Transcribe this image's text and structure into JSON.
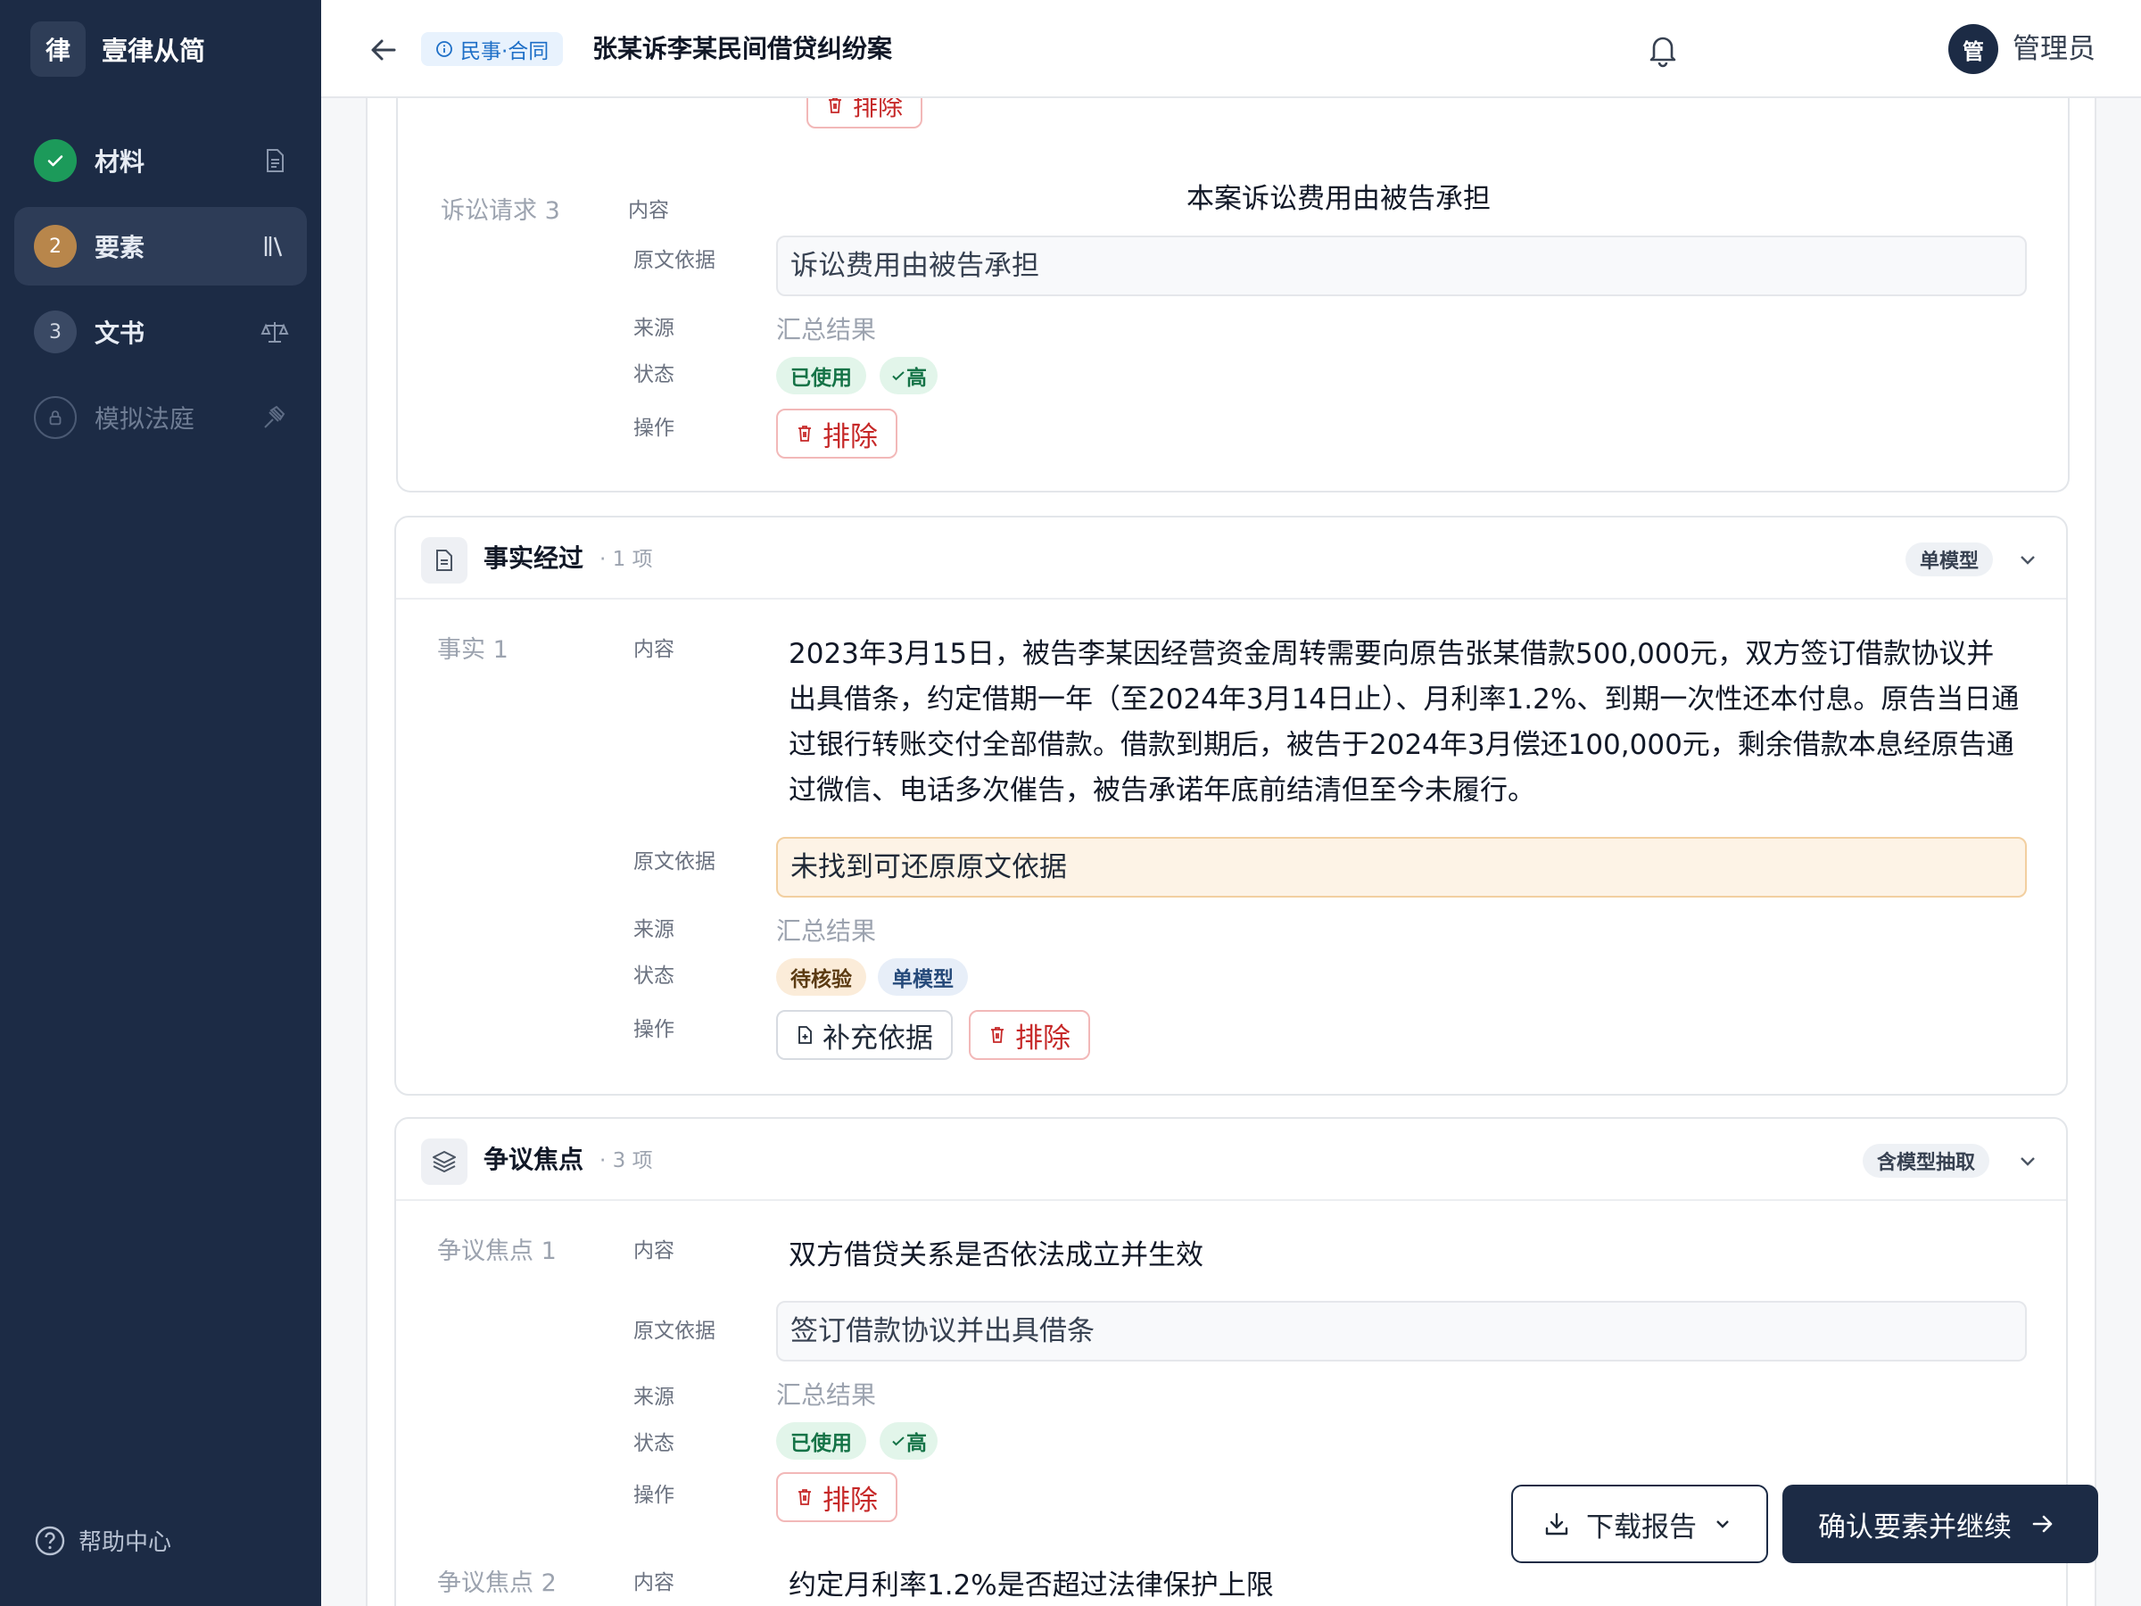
{
  "brand": {
    "logo": "律",
    "name": "壹律从简"
  },
  "nav": [
    {
      "label": "材料",
      "badge": "✓",
      "state": "done",
      "icon": "document-icon"
    },
    {
      "label": "要素",
      "badge": "2",
      "state": "current",
      "icon": "library-icon"
    },
    {
      "label": "文书",
      "badge": "3",
      "state": "pending",
      "icon": "scales-icon"
    },
    {
      "label": "模拟法庭",
      "badge": "",
      "state": "locked",
      "icon": "gavel-icon"
    }
  ],
  "help": {
    "label": "帮助中心"
  },
  "header": {
    "case_tag": "民事·合同",
    "case_title": "张某诉李某民间借贷纠纷案",
    "avatar": "管",
    "user": "管理员"
  },
  "labels": {
    "content": "内容",
    "basis": "原文依据",
    "source": "来源",
    "status": "状态",
    "action": "操作",
    "exclude": "排除",
    "supplement": "补充依据"
  },
  "claim3": {
    "row_label": "诉讼请求 3",
    "content": "本案诉讼费用由被告承担",
    "basis": "诉讼费用由被告承担",
    "source": "汇总结果",
    "status_used": "已使用",
    "confidence": "高"
  },
  "facts": {
    "title": "事实经过",
    "count": "· 1 项",
    "model_badge": "单模型",
    "items": [
      {
        "row_label": "事实 1",
        "content": "2023年3月15日，被告李某因经营资金周转需要向原告张某借款500,000元，双方签订借款协议并出具借条，约定借期一年（至2024年3月14日止）、月利率1.2%、到期一次性还本付息。原告当日通过银行转账交付全部借款。借款到期后，被告于2024年3月偿还100,000元，剩余借款本息经原告通过微信、电话多次催告，被告承诺年底前结清但至今未履行。",
        "basis": "未找到可还原原文依据",
        "source": "汇总结果",
        "status_pending": "待核验",
        "status_model": "单模型"
      }
    ]
  },
  "disputes": {
    "title": "争议焦点",
    "count": "· 3 项",
    "model_badge": "含模型抽取",
    "items": [
      {
        "row_label": "争议焦点 1",
        "content": "双方借贷关系是否依法成立并生效",
        "basis": "签订借款协议并出具借条",
        "source": "汇总结果",
        "status_used": "已使用",
        "confidence": "高"
      },
      {
        "row_label": "争议焦点 2",
        "content": "约定月利率1.2%是否超过法律保护上限"
      }
    ]
  },
  "actions": {
    "download": "下载报告",
    "confirm": "确认要素并继续"
  },
  "colors": {
    "sidebar": "#1c2b45",
    "accent_green": "#157347",
    "danger": "#c62828",
    "warning_bg": "#fdf3e6"
  }
}
